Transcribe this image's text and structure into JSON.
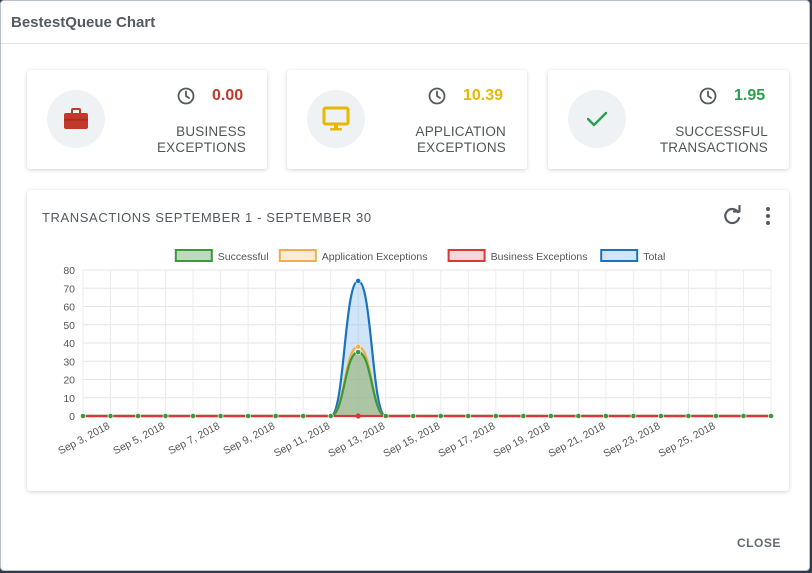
{
  "dialog": {
    "title": "BestestQueue Chart",
    "close_label": "CLOSE"
  },
  "cards": [
    {
      "value": "0.00",
      "label_line1": "BUSINESS",
      "label_line2": "EXCEPTIONS",
      "value_color": "#c0392b",
      "icon": "briefcase-icon"
    },
    {
      "value": "10.39",
      "label_line1": "APPLICATION",
      "label_line2": "EXCEPTIONS",
      "value_color": "#e6b800",
      "icon": "monitor-icon"
    },
    {
      "value": "1.95",
      "label_line1": "SUCCESSFUL",
      "label_line2": "TRANSACTIONS",
      "value_color": "#27a050",
      "icon": "checkmark-icon"
    }
  ],
  "chart_panel": {
    "title": "TRANSACTIONS SEPTEMBER 1 - SEPTEMBER 30"
  },
  "chart_data": {
    "type": "line",
    "title": "",
    "xlabel": "",
    "ylabel": "",
    "ylim": [
      0,
      80
    ],
    "yticks": [
      0,
      10,
      20,
      30,
      40,
      50,
      60,
      70,
      80
    ],
    "grid": true,
    "legend_position": "top-center",
    "x": [
      "Sep 2, 2018",
      "Sep 3, 2018",
      "Sep 4, 2018",
      "Sep 5, 2018",
      "Sep 6, 2018",
      "Sep 7, 2018",
      "Sep 8, 2018",
      "Sep 9, 2018",
      "Sep 10, 2018",
      "Sep 11, 2018",
      "Sep 12, 2018",
      "Sep 13, 2018",
      "Sep 14, 2018",
      "Sep 15, 2018",
      "Sep 16, 2018",
      "Sep 17, 2018",
      "Sep 18, 2018",
      "Sep 19, 2018",
      "Sep 20, 2018",
      "Sep 21, 2018",
      "Sep 22, 2018",
      "Sep 23, 2018",
      "Sep 24, 2018",
      "Sep 25, 2018",
      "Sep 26, 2018",
      "Sep 27, 2018"
    ],
    "tick_labels": [
      "Sep 3, 2018",
      "Sep 5, 2018",
      "Sep 7, 2018",
      "Sep 9, 2018",
      "Sep 11, 2018",
      "Sep 13, 2018",
      "Sep 15, 2018",
      "Sep 17, 2018",
      "Sep 19, 2018",
      "Sep 21, 2018",
      "Sep 23, 2018",
      "Sep 25, 2018"
    ],
    "series": [
      {
        "name": "Total",
        "color": "#1a73c0",
        "fill": "rgba(120,180,235,0.35)",
        "values": [
          0,
          0,
          0,
          0,
          0,
          0,
          0,
          0,
          0,
          0,
          74,
          0,
          0,
          0,
          0,
          0,
          0,
          0,
          0,
          0,
          0,
          0,
          0,
          0,
          0,
          0
        ]
      },
      {
        "name": "Application Exceptions",
        "color": "#f0ad4e",
        "fill": "rgba(245,200,140,0.35)",
        "values": [
          0,
          0,
          0,
          0,
          0,
          0,
          0,
          0,
          0,
          0,
          38,
          0,
          0,
          0,
          0,
          0,
          0,
          0,
          0,
          0,
          0,
          0,
          0,
          0,
          0,
          0
        ]
      },
      {
        "name": "Successful",
        "color": "#3a9a3a",
        "fill": "rgba(110,170,110,0.45)",
        "values": [
          0,
          0,
          0,
          0,
          0,
          0,
          0,
          0,
          0,
          0,
          35,
          0,
          0,
          0,
          0,
          0,
          0,
          0,
          0,
          0,
          0,
          0,
          0,
          0,
          0,
          0
        ]
      },
      {
        "name": "Business Exceptions",
        "color": "#d9383a",
        "fill": "rgba(235,140,140,0.35)",
        "values": [
          0,
          0,
          0,
          0,
          0,
          0,
          0,
          0,
          0,
          0,
          0,
          0,
          0,
          0,
          0,
          0,
          0,
          0,
          0,
          0,
          0,
          0,
          0,
          0,
          0,
          0
        ]
      }
    ],
    "legend_order": [
      "Successful",
      "Application Exceptions",
      "Business Exceptions",
      "Total"
    ]
  }
}
